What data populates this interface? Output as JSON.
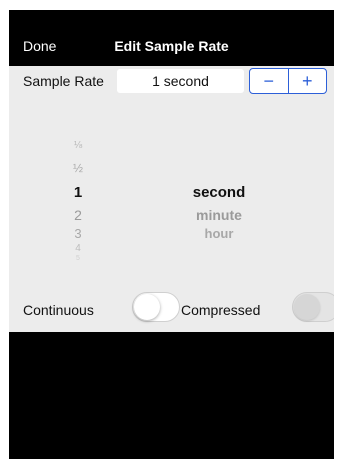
{
  "navbar": {
    "done_label": "Done",
    "title": "Edit Sample Rate"
  },
  "sample_rate": {
    "label": "Sample Rate",
    "value": "1 second",
    "decrement_symbol": "−",
    "increment_symbol": "+"
  },
  "picker": {
    "numbers": [
      "⅛",
      "½",
      "1",
      "2",
      "3",
      "4",
      "5"
    ],
    "selected_number": "1",
    "units": [
      "second",
      "minute",
      "hour"
    ],
    "selected_unit": "second"
  },
  "toggles": {
    "continuous_label": "Continuous",
    "continuous_on": false,
    "compressed_label": "Compressed",
    "compressed_on": false,
    "compressed_enabled": false
  },
  "colors": {
    "accent": "#2c5fd8",
    "panel": "#ececec",
    "background": "#000000"
  }
}
